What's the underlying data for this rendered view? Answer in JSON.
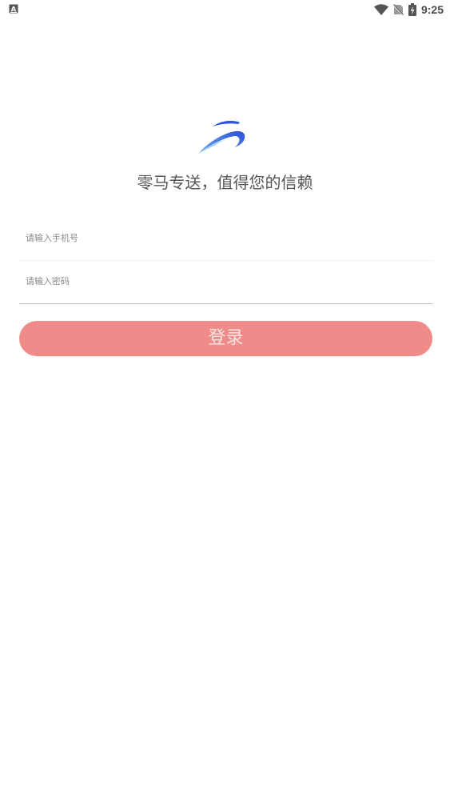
{
  "status_bar": {
    "time": "9:25",
    "icons": [
      "a-notification-icon",
      "wifi-icon",
      "no-sim-icon",
      "battery-charging-icon"
    ]
  },
  "brand": {
    "logo_icon": "horse-swoosh-logo",
    "slogan": "零马专送，值得您的信赖"
  },
  "form": {
    "phone_placeholder": "请输入手机号",
    "password_placeholder": "请输入密码",
    "phone_value": "",
    "password_value": "",
    "login_label": "登录"
  },
  "colors": {
    "primary": "#ef8c8a",
    "logo_blue": "#3b5fe0",
    "text": "#555555"
  }
}
